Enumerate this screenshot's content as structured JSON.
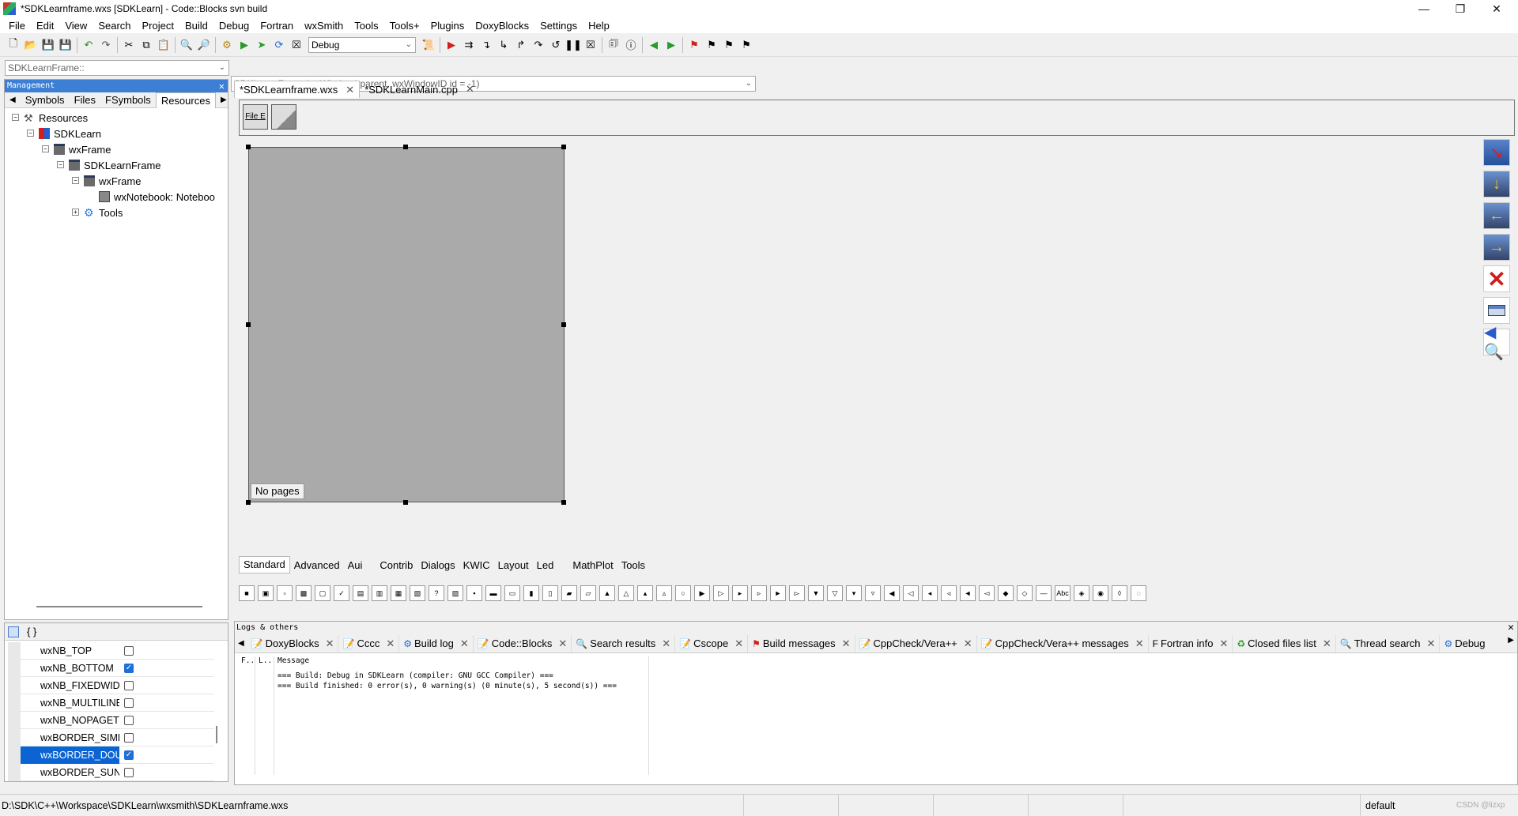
{
  "window": {
    "title": "*SDKLearnframe.wxs [SDKLearn] - Code::Blocks svn build"
  },
  "menu": [
    "File",
    "Edit",
    "View",
    "Search",
    "Project",
    "Build",
    "Debug",
    "Fortran",
    "wxSmith",
    "Tools",
    "Tools+",
    "Plugins",
    "DoxyBlocks",
    "Settings",
    "Help"
  ],
  "toolbar": {
    "build_target": "Debug"
  },
  "scope": {
    "class_combo": "SDKLearnFrame::",
    "function_combo": "SDKLearnFrame(wxWindow* parent, wxWindowID id = -1)"
  },
  "management": {
    "title": "Management",
    "tabs": [
      "Symbols",
      "Files",
      "FSymbols",
      "Resources"
    ],
    "active_tab": "Resources",
    "tree": [
      "Resources",
      "SDKLearn",
      "wxFrame",
      "SDKLearnFrame",
      "wxFrame",
      "wxNotebook: Noteboo",
      "Tools"
    ]
  },
  "properties": {
    "braces": "{ }",
    "rows": [
      {
        "name": "wxNB_TOP",
        "checked": false
      },
      {
        "name": "wxNB_BOTTOM",
        "checked": true
      },
      {
        "name": "wxNB_FIXEDWIDT",
        "checked": false
      },
      {
        "name": "wxNB_MULTILINE",
        "checked": false
      },
      {
        "name": "wxNB_NOPAGETI",
        "checked": false
      },
      {
        "name": "wxBORDER_SIMP",
        "checked": false
      },
      {
        "name": "wxBORDER_DOU",
        "checked": true
      },
      {
        "name": "wxBORDER_SUNI",
        "checked": false
      }
    ]
  },
  "editor": {
    "tabs": [
      "*SDKLearnframe.wxs",
      "*SDKLearnMain.cpp"
    ],
    "palette_label": "File E",
    "no_pages": "No pages",
    "component_tabs": [
      "Standard",
      "Advanced",
      "Aui",
      "Contrib",
      "Dialogs",
      "KWIC",
      "Layout",
      "Led",
      "MathPlot",
      "Tools"
    ]
  },
  "logs": {
    "title": "Logs & others",
    "tabs": [
      "DoxyBlocks",
      "Cccc",
      "Build log",
      "Code::Blocks",
      "Search results",
      "Cscope",
      "Build messages",
      "CppCheck/Vera++",
      "CppCheck/Vera++ messages",
      "Fortran info",
      "Closed files list",
      "Thread search",
      "Debug"
    ],
    "columns": [
      "F..",
      "L..",
      "Message"
    ],
    "messages": [
      "=== Build: Debug in SDKLearn (compiler: GNU GCC Compiler) ===",
      "=== Build finished: 0 error(s), 0 warning(s) (0 minute(s), 5 second(s)) ==="
    ]
  },
  "status": {
    "path": "D:\\SDK\\C++\\Workspace\\SDKLearn\\wxsmith\\SDKLearnframe.wxs",
    "mode": "default",
    "watermark": "CSDN @lizxp"
  }
}
